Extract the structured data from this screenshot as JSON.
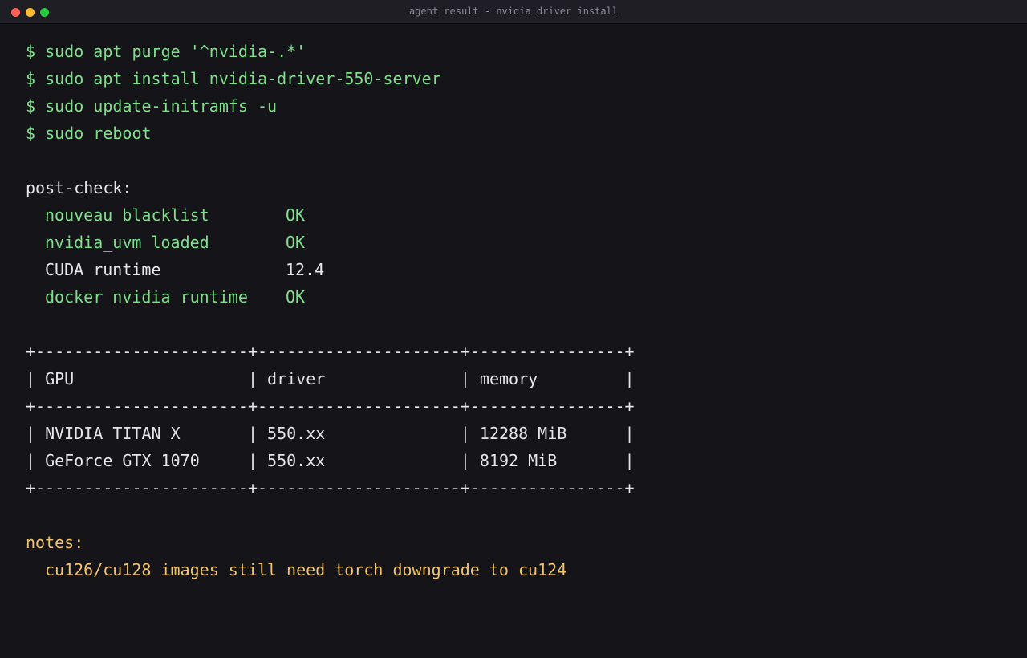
{
  "window": {
    "title": "agent result - nvidia driver install"
  },
  "commands": [
    "$ sudo apt purge '^nvidia-.*'",
    "$ sudo apt install nvidia-driver-550-server",
    "$ sudo update-initramfs -u",
    "$ sudo reboot"
  ],
  "post_check": {
    "heading": "post-check:",
    "items": [
      {
        "label": "nouveau blacklist",
        "value": "OK"
      },
      {
        "label": "nvidia_uvm loaded",
        "value": "OK"
      },
      {
        "label": "CUDA runtime",
        "value": "12.4"
      },
      {
        "label": "docker nvidia runtime",
        "value": "OK"
      }
    ]
  },
  "table": {
    "border": "+----------------------+---------------------+----------------+",
    "header_row": "| GPU                  | driver              | memory         |",
    "rows": [
      "| NVIDIA TITAN X       | 550.xx              | 12288 MiB      |",
      "| GeForce GTX 1070     | 550.xx              | 8192 MiB       |"
    ]
  },
  "notes": {
    "heading": "notes:",
    "items": [
      "cu126/cu128 images still need torch downgrade to cu124"
    ]
  },
  "colors": {
    "background": "#141419",
    "titlebar": "#1e1e24",
    "ok_green": "#7ee08a",
    "text_white": "#e6e6ea",
    "notes_yellow": "#f3c46c"
  }
}
